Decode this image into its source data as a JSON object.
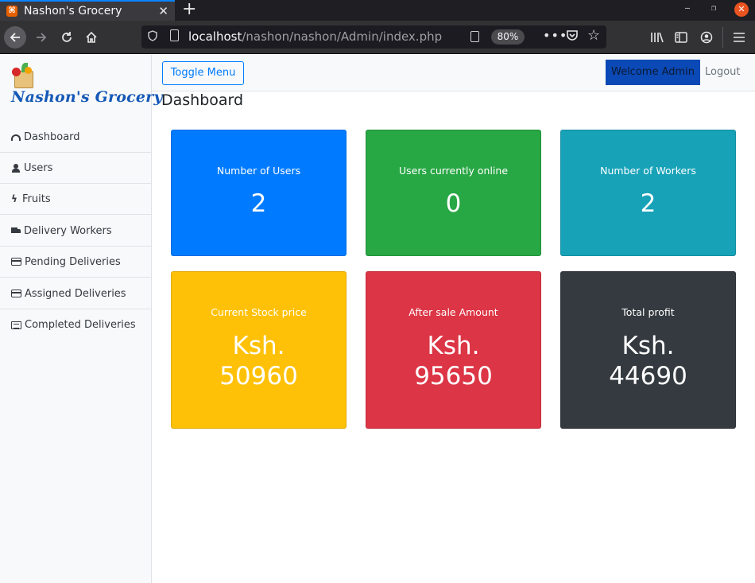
{
  "browser": {
    "tab_title": "Nashon's Grocery",
    "tab_close": "✕",
    "new_tab": "+",
    "url_host": "localhost",
    "url_path": "/nashon/nashon/Admin/index.php",
    "zoom": "80%"
  },
  "sidebar": {
    "brand": "Nashon's Grocery",
    "items": [
      {
        "label": "Dashboard",
        "icon": "dashboard-icon"
      },
      {
        "label": "Users",
        "icon": "user-icon"
      },
      {
        "label": "Fruits",
        "icon": "fruit-icon"
      },
      {
        "label": "Delivery Workers",
        "icon": "truck-icon"
      },
      {
        "label": "Pending Deliveries",
        "icon": "credit-card-icon"
      },
      {
        "label": "Assigned Deliveries",
        "icon": "credit-card-icon"
      },
      {
        "label": "Completed Deliveries",
        "icon": "list-icon"
      }
    ]
  },
  "topbar": {
    "toggle_label": "Toggle Menu",
    "welcome_label": "Welcome Admin",
    "logout_label": "Logout"
  },
  "main": {
    "title": "Dashboard",
    "cards": [
      {
        "label": "Number of Users",
        "value": "2",
        "color": "#007bff"
      },
      {
        "label": "Users currently online",
        "value": "0",
        "color": "#28a745"
      },
      {
        "label": "Number of Workers",
        "value": "2",
        "color": "#17a2b8"
      },
      {
        "label": "Current Stock price",
        "value_line1": "Ksh.",
        "value_line2": "50960",
        "color": "#ffc107"
      },
      {
        "label": "After sale Amount",
        "value_line1": "Ksh.",
        "value_line2": "95650",
        "color": "#dc3545"
      },
      {
        "label": "Total profit",
        "value_line1": "Ksh.",
        "value_line2": "44690",
        "color": "#343a40"
      }
    ]
  }
}
